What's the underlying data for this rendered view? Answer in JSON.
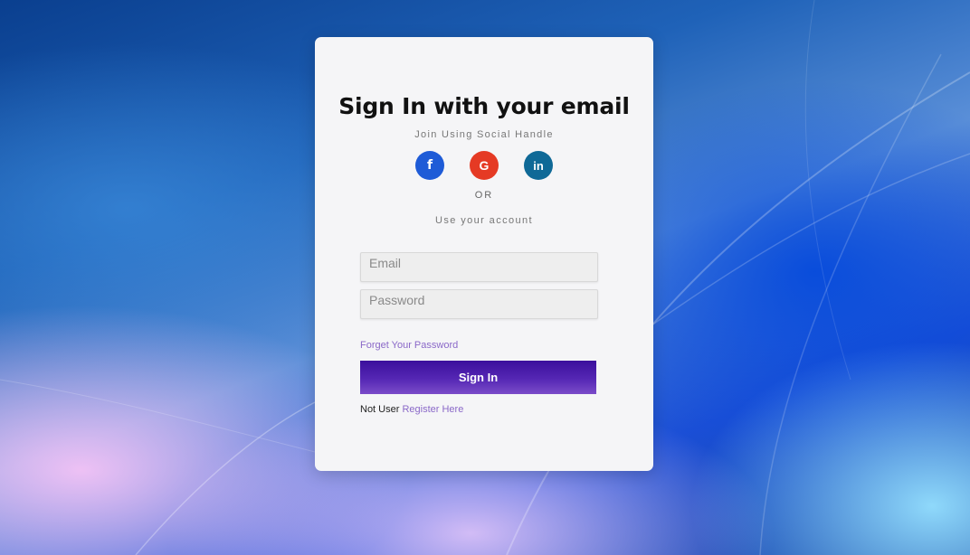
{
  "card": {
    "title": "Sign In with your email",
    "subtitle": "Join Using Social Handle",
    "social": [
      {
        "name": "facebook",
        "glyph": "f",
        "color": "#1e5bd7",
        "icon": "facebook-icon"
      },
      {
        "name": "google",
        "glyph": "G",
        "color": "#e53a24",
        "icon": "google-icon"
      },
      {
        "name": "linkedin",
        "glyph": "in",
        "color": "#0f6997",
        "icon": "linkedin-icon"
      }
    ],
    "or_label": "OR",
    "use_account_label": "Use your account",
    "email_placeholder": "Email",
    "password_placeholder": "Password",
    "forget_password_link": "Forget Your Password",
    "signin_button": "Sign In",
    "not_user_text": "Not User",
    "register_link": "Register Here"
  },
  "colors": {
    "accent_link": "#8a68c8",
    "button_gradient_top": "#3b0f9c",
    "button_gradient_bottom": "#7b4cc9"
  }
}
